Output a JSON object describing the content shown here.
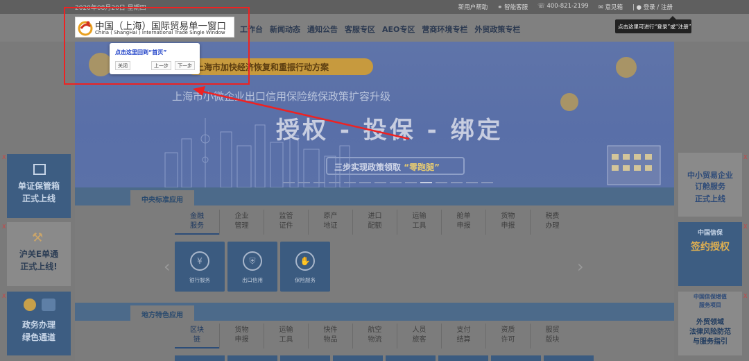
{
  "topbar": {
    "date": "2020年08月20日 星期四",
    "links": [
      "新用户帮助",
      "智能客服",
      "400-821-2199",
      "意见箱",
      "登录 / 注册"
    ]
  },
  "logo": {
    "cn": "中国（上海）国际贸易单一窗口",
    "en": "China ( ShangHai ) International Trade Single Window"
  },
  "nav": [
    "工作台",
    "新闻动态",
    "通知公告",
    "客服专区",
    "AEO专区",
    "营商环境专栏",
    "外贸政策专栏"
  ],
  "tooltip": "点击这里可进行“登录”或“注册”",
  "guide": {
    "message": "点击这里回到“首页”",
    "close": "关闭",
    "prev": "上一步",
    "next": "下一步"
  },
  "banner": {
    "tag": "上海市加快经济恢复和重振行动方案",
    "subtitle": "上海市小微企业出口信用保险统保政策扩容升级",
    "headline": "授权 - 投保 - 绑定",
    "pill_prefix": "三步实现政策领取",
    "pill_highlight": "“零跑腿”"
  },
  "central": {
    "title": "中央标准应用",
    "categories": [
      "金融服务",
      "企业管理",
      "监管证件",
      "原产地证",
      "进口配额",
      "运输工具",
      "舱单申报",
      "货物申报",
      "税费办理"
    ],
    "tiles": [
      "银行服务",
      "出口信用",
      "保险服务"
    ]
  },
  "local": {
    "title": "地方特色应用",
    "categories": [
      "区块链",
      "货物申报",
      "运输工具",
      "快件物品",
      "航空物流",
      "人员旅客",
      "支付结算",
      "资质许可",
      "服贸版块"
    ]
  },
  "left_ads": [
    {
      "line1": "单证保管箱",
      "line2": "正式上线"
    },
    {
      "line1": "沪关E单通",
      "line2": "正式上线!"
    },
    {
      "line1": "政务办理",
      "line2": "绿色通道"
    }
  ],
  "right_ads": [
    {
      "line1": "中小贸易企业",
      "line2": "订舱服务",
      "line3": "正式上线"
    },
    {
      "line1": "中国信保",
      "line2": "签约授权"
    },
    {
      "line1": "中国信保增值",
      "line2": "服务项目",
      "line3": "外贸领域",
      "line4": "法律风险防范",
      "line5": "与服务指引"
    }
  ],
  "close_mark": "X"
}
